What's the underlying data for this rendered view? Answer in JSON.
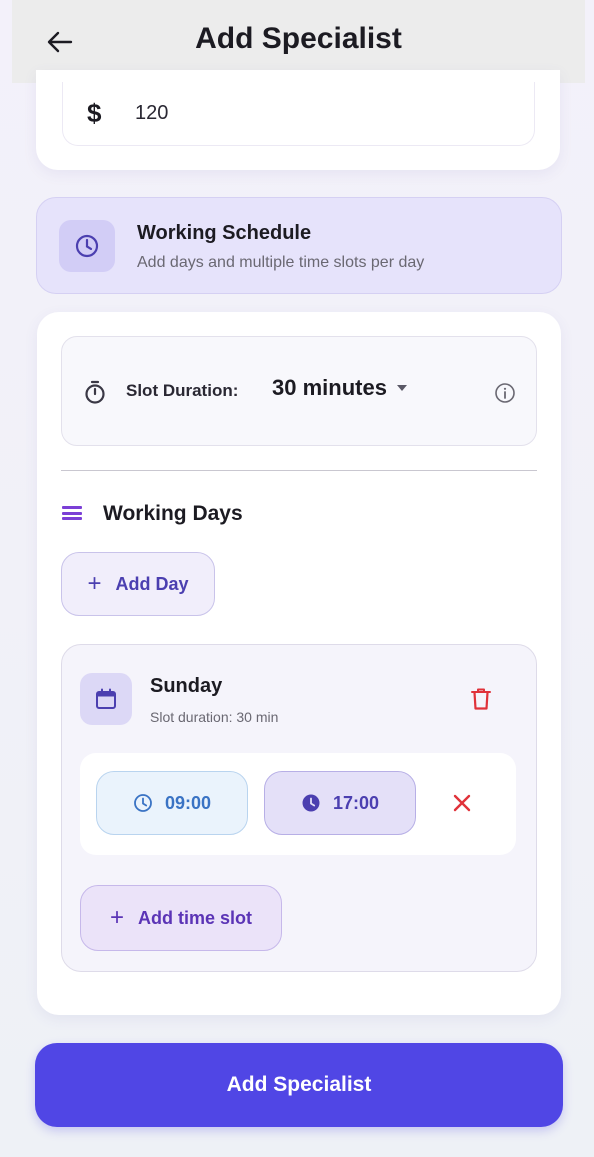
{
  "header": {
    "title": "Add Specialist",
    "back_icon": "arrow-left-icon"
  },
  "price": {
    "currency_symbol": "$",
    "value": "120"
  },
  "working_schedule": {
    "title": "Working Schedule",
    "subtitle": "Add days and multiple time slots per day",
    "icon": "clock-icon"
  },
  "slot_duration": {
    "label": "Slot Duration:",
    "selected": "30 minutes",
    "icon": "timer-icon",
    "info_icon": "info-icon"
  },
  "working_days": {
    "title": "Working Days",
    "add_day_label": "Add Day",
    "days": [
      {
        "name": "Sunday",
        "subtitle": "Slot duration: 30 min",
        "slots": [
          {
            "start": "09:00",
            "end": "17:00"
          }
        ],
        "add_slot_label": "Add time slot"
      }
    ]
  },
  "submit_label": "Add Specialist",
  "colors": {
    "primary": "#5046e5",
    "danger": "#e0323a",
    "accent_purple": "#7b3fd6",
    "start_time_blue": "#3a73c4"
  }
}
